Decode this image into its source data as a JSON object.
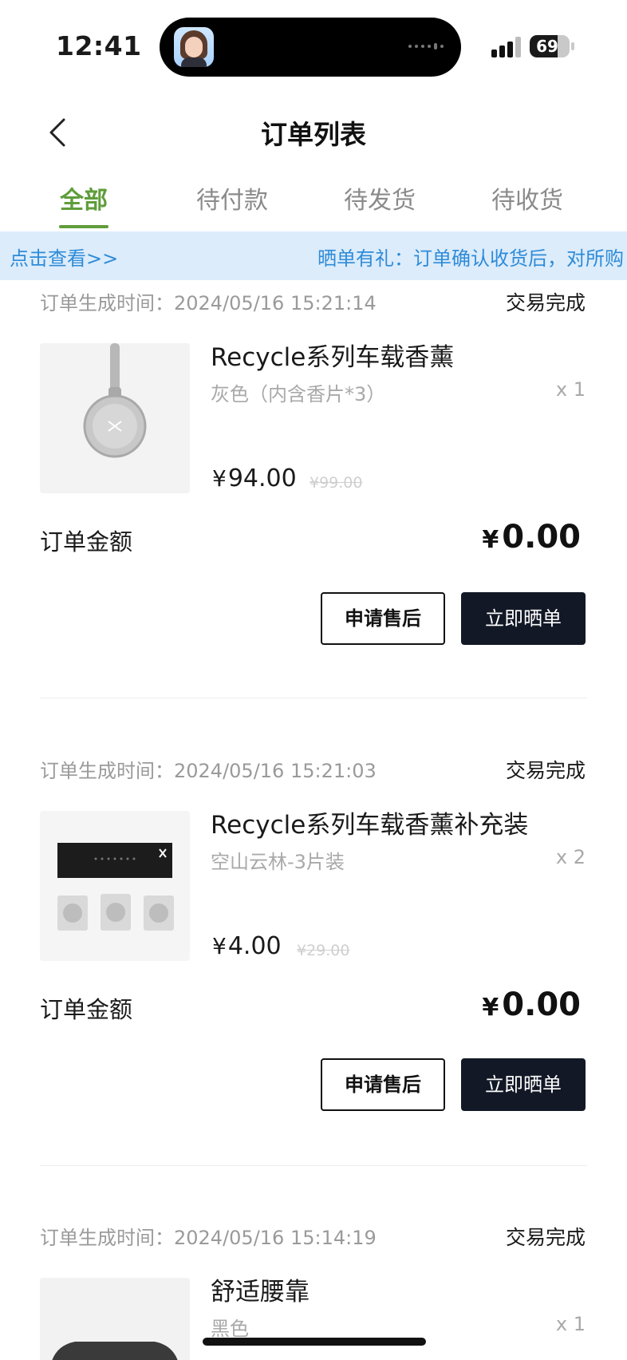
{
  "status_bar": {
    "time": "12:41",
    "battery": "69",
    "battery_level": 0.69
  },
  "nav": {
    "title": "订单列表",
    "back_icon": "chevron-left-icon"
  },
  "tabs": [
    {
      "label": "全部",
      "active": true
    },
    {
      "label": "待付款",
      "active": false
    },
    {
      "label": "待发货",
      "active": false
    },
    {
      "label": "待收货",
      "active": false
    }
  ],
  "banner": {
    "link": "点击查看>>",
    "marquee": "晒单有礼：订单确认收货后，对所购"
  },
  "labels": {
    "order_time_prefix": "订单生成时间：",
    "amount_label": "订单金额",
    "currency": "¥",
    "qty_prefix": "x "
  },
  "orders": [
    {
      "time": "2024/05/16 15:21:14",
      "status": "交易完成",
      "product": "Recycle系列车载香薰",
      "variant": "灰色（内含香片*3）",
      "qty": "x 1",
      "price": "94.00",
      "orig_price": "¥99.00",
      "amount": "0.00",
      "after_sale": "申请售后",
      "review": "立即晒单"
    },
    {
      "time": "2024/05/16 15:21:03",
      "status": "交易完成",
      "product": "Recycle系列车载香薰补充装",
      "variant": "空山云林-3片装",
      "qty": "x 2",
      "price": "4.00",
      "orig_price": "¥29.00",
      "amount": "0.00",
      "after_sale": "申请售后",
      "review": "立即晒单"
    },
    {
      "time": "2024/05/16 15:14:19",
      "status": "交易完成",
      "product": "舒适腰靠",
      "variant": "黑色",
      "qty": "x 1"
    }
  ],
  "colors": {
    "accent": "#5f9d3b",
    "banner_bg": "#dcecfb",
    "banner_text": "#2e8bd8",
    "button_dark": "#121826"
  }
}
